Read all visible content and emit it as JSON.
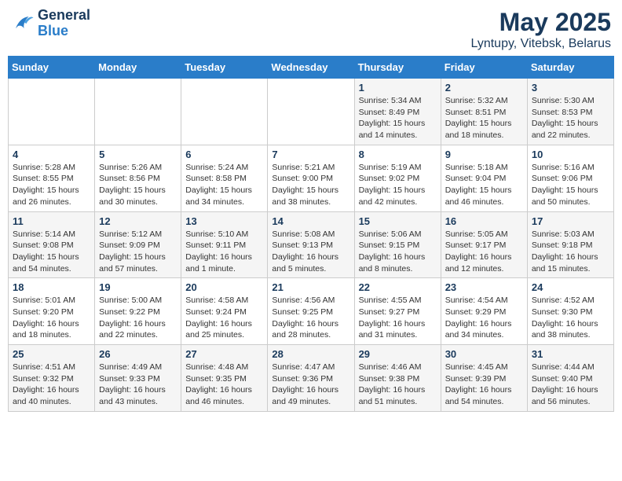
{
  "header": {
    "logo_line1": "General",
    "logo_line2": "Blue",
    "title": "May 2025",
    "subtitle": "Lyntupy, Vitebsk, Belarus"
  },
  "days_of_week": [
    "Sunday",
    "Monday",
    "Tuesday",
    "Wednesday",
    "Thursday",
    "Friday",
    "Saturday"
  ],
  "weeks": [
    [
      {
        "num": "",
        "info": ""
      },
      {
        "num": "",
        "info": ""
      },
      {
        "num": "",
        "info": ""
      },
      {
        "num": "",
        "info": ""
      },
      {
        "num": "1",
        "info": "Sunrise: 5:34 AM\nSunset: 8:49 PM\nDaylight: 15 hours\nand 14 minutes."
      },
      {
        "num": "2",
        "info": "Sunrise: 5:32 AM\nSunset: 8:51 PM\nDaylight: 15 hours\nand 18 minutes."
      },
      {
        "num": "3",
        "info": "Sunrise: 5:30 AM\nSunset: 8:53 PM\nDaylight: 15 hours\nand 22 minutes."
      }
    ],
    [
      {
        "num": "4",
        "info": "Sunrise: 5:28 AM\nSunset: 8:55 PM\nDaylight: 15 hours\nand 26 minutes."
      },
      {
        "num": "5",
        "info": "Sunrise: 5:26 AM\nSunset: 8:56 PM\nDaylight: 15 hours\nand 30 minutes."
      },
      {
        "num": "6",
        "info": "Sunrise: 5:24 AM\nSunset: 8:58 PM\nDaylight: 15 hours\nand 34 minutes."
      },
      {
        "num": "7",
        "info": "Sunrise: 5:21 AM\nSunset: 9:00 PM\nDaylight: 15 hours\nand 38 minutes."
      },
      {
        "num": "8",
        "info": "Sunrise: 5:19 AM\nSunset: 9:02 PM\nDaylight: 15 hours\nand 42 minutes."
      },
      {
        "num": "9",
        "info": "Sunrise: 5:18 AM\nSunset: 9:04 PM\nDaylight: 15 hours\nand 46 minutes."
      },
      {
        "num": "10",
        "info": "Sunrise: 5:16 AM\nSunset: 9:06 PM\nDaylight: 15 hours\nand 50 minutes."
      }
    ],
    [
      {
        "num": "11",
        "info": "Sunrise: 5:14 AM\nSunset: 9:08 PM\nDaylight: 15 hours\nand 54 minutes."
      },
      {
        "num": "12",
        "info": "Sunrise: 5:12 AM\nSunset: 9:09 PM\nDaylight: 15 hours\nand 57 minutes."
      },
      {
        "num": "13",
        "info": "Sunrise: 5:10 AM\nSunset: 9:11 PM\nDaylight: 16 hours\nand 1 minute."
      },
      {
        "num": "14",
        "info": "Sunrise: 5:08 AM\nSunset: 9:13 PM\nDaylight: 16 hours\nand 5 minutes."
      },
      {
        "num": "15",
        "info": "Sunrise: 5:06 AM\nSunset: 9:15 PM\nDaylight: 16 hours\nand 8 minutes."
      },
      {
        "num": "16",
        "info": "Sunrise: 5:05 AM\nSunset: 9:17 PM\nDaylight: 16 hours\nand 12 minutes."
      },
      {
        "num": "17",
        "info": "Sunrise: 5:03 AM\nSunset: 9:18 PM\nDaylight: 16 hours\nand 15 minutes."
      }
    ],
    [
      {
        "num": "18",
        "info": "Sunrise: 5:01 AM\nSunset: 9:20 PM\nDaylight: 16 hours\nand 18 minutes."
      },
      {
        "num": "19",
        "info": "Sunrise: 5:00 AM\nSunset: 9:22 PM\nDaylight: 16 hours\nand 22 minutes."
      },
      {
        "num": "20",
        "info": "Sunrise: 4:58 AM\nSunset: 9:24 PM\nDaylight: 16 hours\nand 25 minutes."
      },
      {
        "num": "21",
        "info": "Sunrise: 4:56 AM\nSunset: 9:25 PM\nDaylight: 16 hours\nand 28 minutes."
      },
      {
        "num": "22",
        "info": "Sunrise: 4:55 AM\nSunset: 9:27 PM\nDaylight: 16 hours\nand 31 minutes."
      },
      {
        "num": "23",
        "info": "Sunrise: 4:54 AM\nSunset: 9:29 PM\nDaylight: 16 hours\nand 34 minutes."
      },
      {
        "num": "24",
        "info": "Sunrise: 4:52 AM\nSunset: 9:30 PM\nDaylight: 16 hours\nand 38 minutes."
      }
    ],
    [
      {
        "num": "25",
        "info": "Sunrise: 4:51 AM\nSunset: 9:32 PM\nDaylight: 16 hours\nand 40 minutes."
      },
      {
        "num": "26",
        "info": "Sunrise: 4:49 AM\nSunset: 9:33 PM\nDaylight: 16 hours\nand 43 minutes."
      },
      {
        "num": "27",
        "info": "Sunrise: 4:48 AM\nSunset: 9:35 PM\nDaylight: 16 hours\nand 46 minutes."
      },
      {
        "num": "28",
        "info": "Sunrise: 4:47 AM\nSunset: 9:36 PM\nDaylight: 16 hours\nand 49 minutes."
      },
      {
        "num": "29",
        "info": "Sunrise: 4:46 AM\nSunset: 9:38 PM\nDaylight: 16 hours\nand 51 minutes."
      },
      {
        "num": "30",
        "info": "Sunrise: 4:45 AM\nSunset: 9:39 PM\nDaylight: 16 hours\nand 54 minutes."
      },
      {
        "num": "31",
        "info": "Sunrise: 4:44 AM\nSunset: 9:40 PM\nDaylight: 16 hours\nand 56 minutes."
      }
    ]
  ]
}
